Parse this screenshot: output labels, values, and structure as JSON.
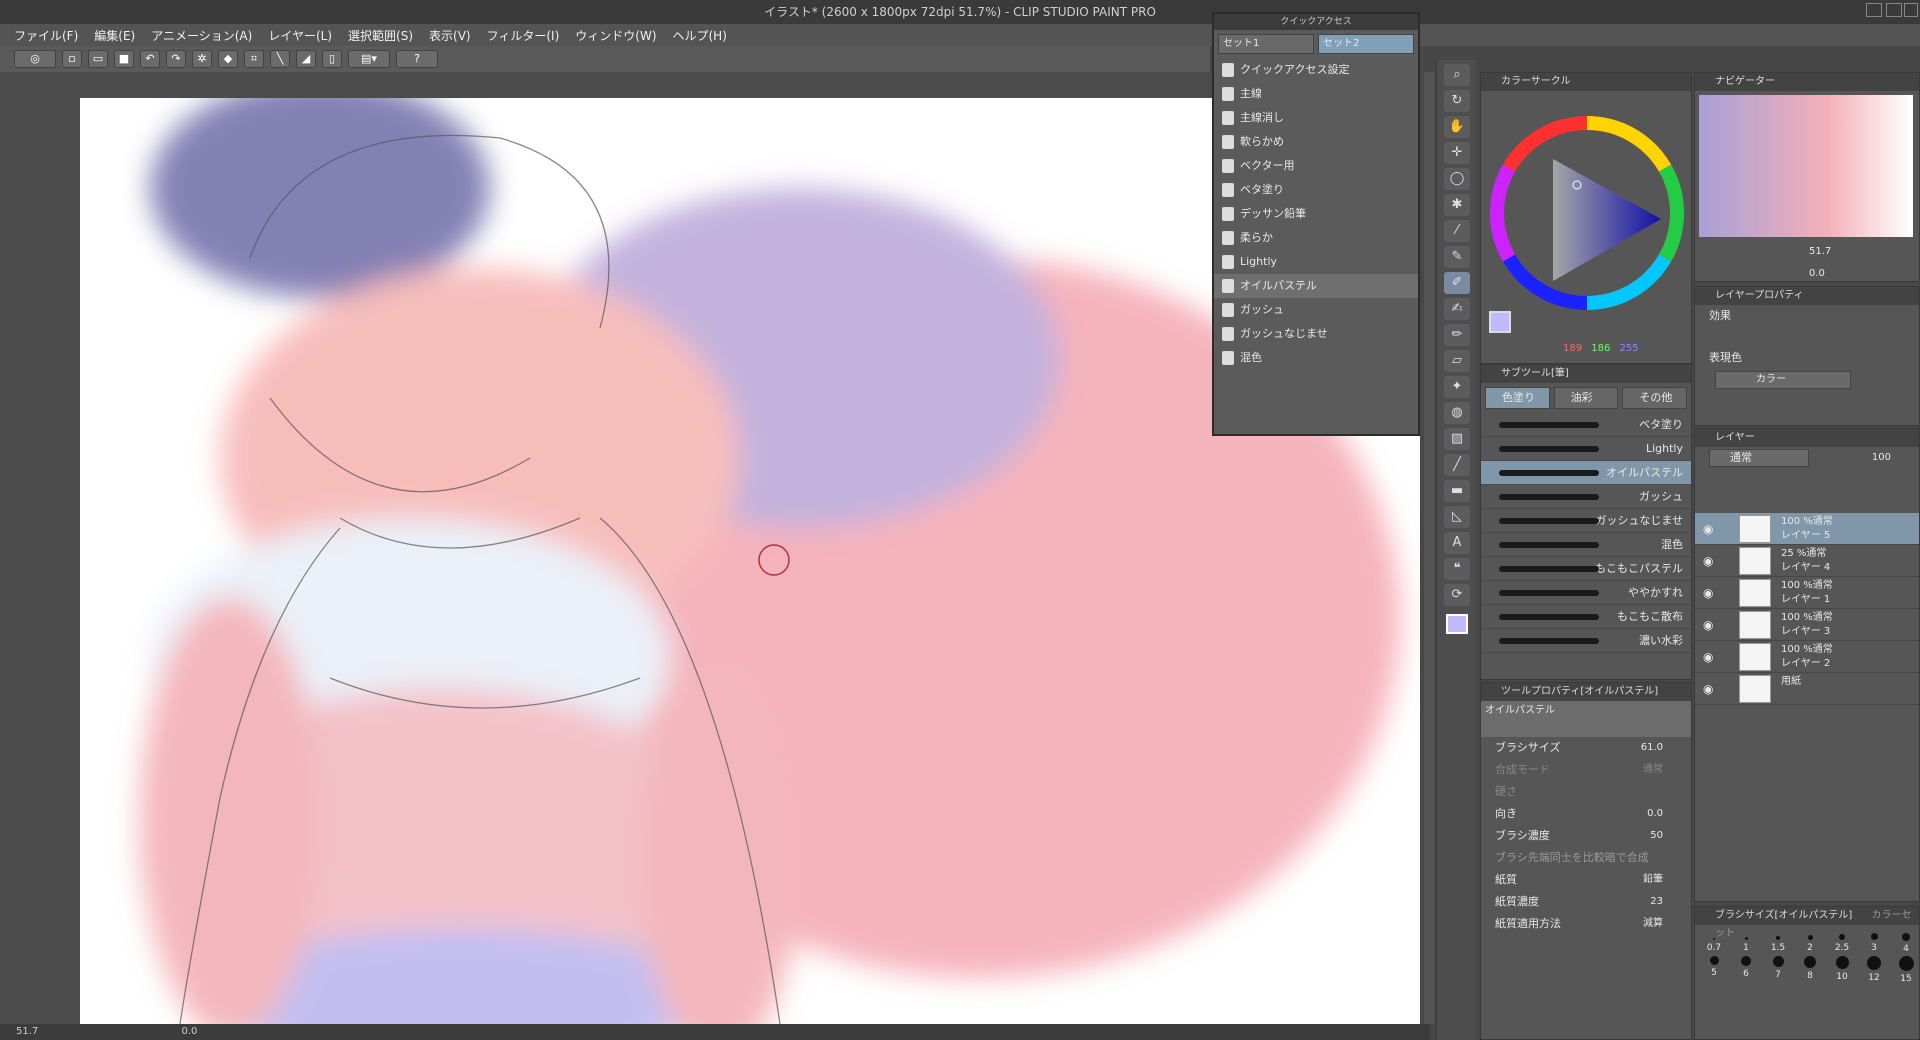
{
  "window": {
    "title": "イラスト* (2600 x 1800px 72dpi 51.7%)  - CLIP STUDIO PAINT PRO"
  },
  "menu": [
    "ファイル(F)",
    "編集(E)",
    "アニメーション(A)",
    "レイヤー(L)",
    "選択範囲(S)",
    "表示(V)",
    "フィルター(I)",
    "ウィンドウ(W)",
    "ヘルプ(H)"
  ],
  "quick_access": {
    "title": "クイックアクセス",
    "tabs": [
      "セット1",
      "セット2"
    ],
    "items": [
      "クイックアクセス設定",
      "主線",
      "主線消し",
      "軟らかめ",
      "ベクター用",
      "ベタ塗り",
      "デッサン鉛筆",
      "柔らか",
      "Lightly",
      "オイルパステル",
      "ガッシュ",
      "ガッシュなじませ",
      "混色"
    ]
  },
  "color_panel": {
    "tab": "カラーサークル",
    "r": "189",
    "g": "186",
    "b": "255",
    "accent": "#bdbaff"
  },
  "navigator": {
    "tab": "ナビゲーター",
    "zoom": "51.7",
    "angle": "0.0"
  },
  "layer_property": {
    "tab": "レイヤープロパティ",
    "effect_label": "効果",
    "express_label": "表現色",
    "express_value": "カラー"
  },
  "subtool": {
    "tab": "サブツール[筆]",
    "groups": [
      "色塗り",
      "油彩",
      "その他"
    ],
    "brushes": [
      "ベタ塗り",
      "Lightly",
      "オイルパステル",
      "ガッシュ",
      "ガッシュなじませ",
      "混色",
      "もこもこパステル",
      "ややかすれ",
      "もこもこ散布",
      "濃い水彩"
    ]
  },
  "tool_property": {
    "tab": "ツールプロパティ[オイルパステル]",
    "brush_name": "オイルパステル",
    "brush_size_label": "ブラシサイズ",
    "brush_size": "61.0",
    "blend_label": "合成モード",
    "blend_value": "通常",
    "hardness_label": "硬さ",
    "direction_label": "向き",
    "direction": "0.0",
    "density_label": "ブラシ濃度",
    "density": "50",
    "compare_label": "ブラシ先端同士を比較暗で合成",
    "paper_label": "紙質",
    "paper_value": "鉛筆",
    "paper_density_label": "紙質濃度",
    "paper_density": "23",
    "paper_method_label": "紙質適用方法",
    "paper_method": "減算"
  },
  "layers": {
    "tab": "レイヤー",
    "blend": "通常",
    "opacity": "100",
    "items": [
      {
        "pct": "100 %通常",
        "name": "レイヤー 5"
      },
      {
        "pct": "25 %通常",
        "name": "レイヤー 4"
      },
      {
        "pct": "100 %通常",
        "name": "レイヤー 1"
      },
      {
        "pct": "100 %通常",
        "name": "レイヤー 3"
      },
      {
        "pct": "100 %通常",
        "name": "レイヤー 2"
      },
      {
        "pct": "",
        "name": "用紙"
      }
    ]
  },
  "brush_size_panel": {
    "tab": "ブラシサイズ[オイルパステル]",
    "tab2": "カラーセット",
    "sizes": [
      "0.7",
      "1",
      "1.5",
      "2",
      "2.5",
      "3",
      "4",
      "5",
      "6",
      "7",
      "8",
      "10",
      "12",
      "15"
    ]
  },
  "status": {
    "zoom": "51.7",
    "angle": "0.0"
  }
}
